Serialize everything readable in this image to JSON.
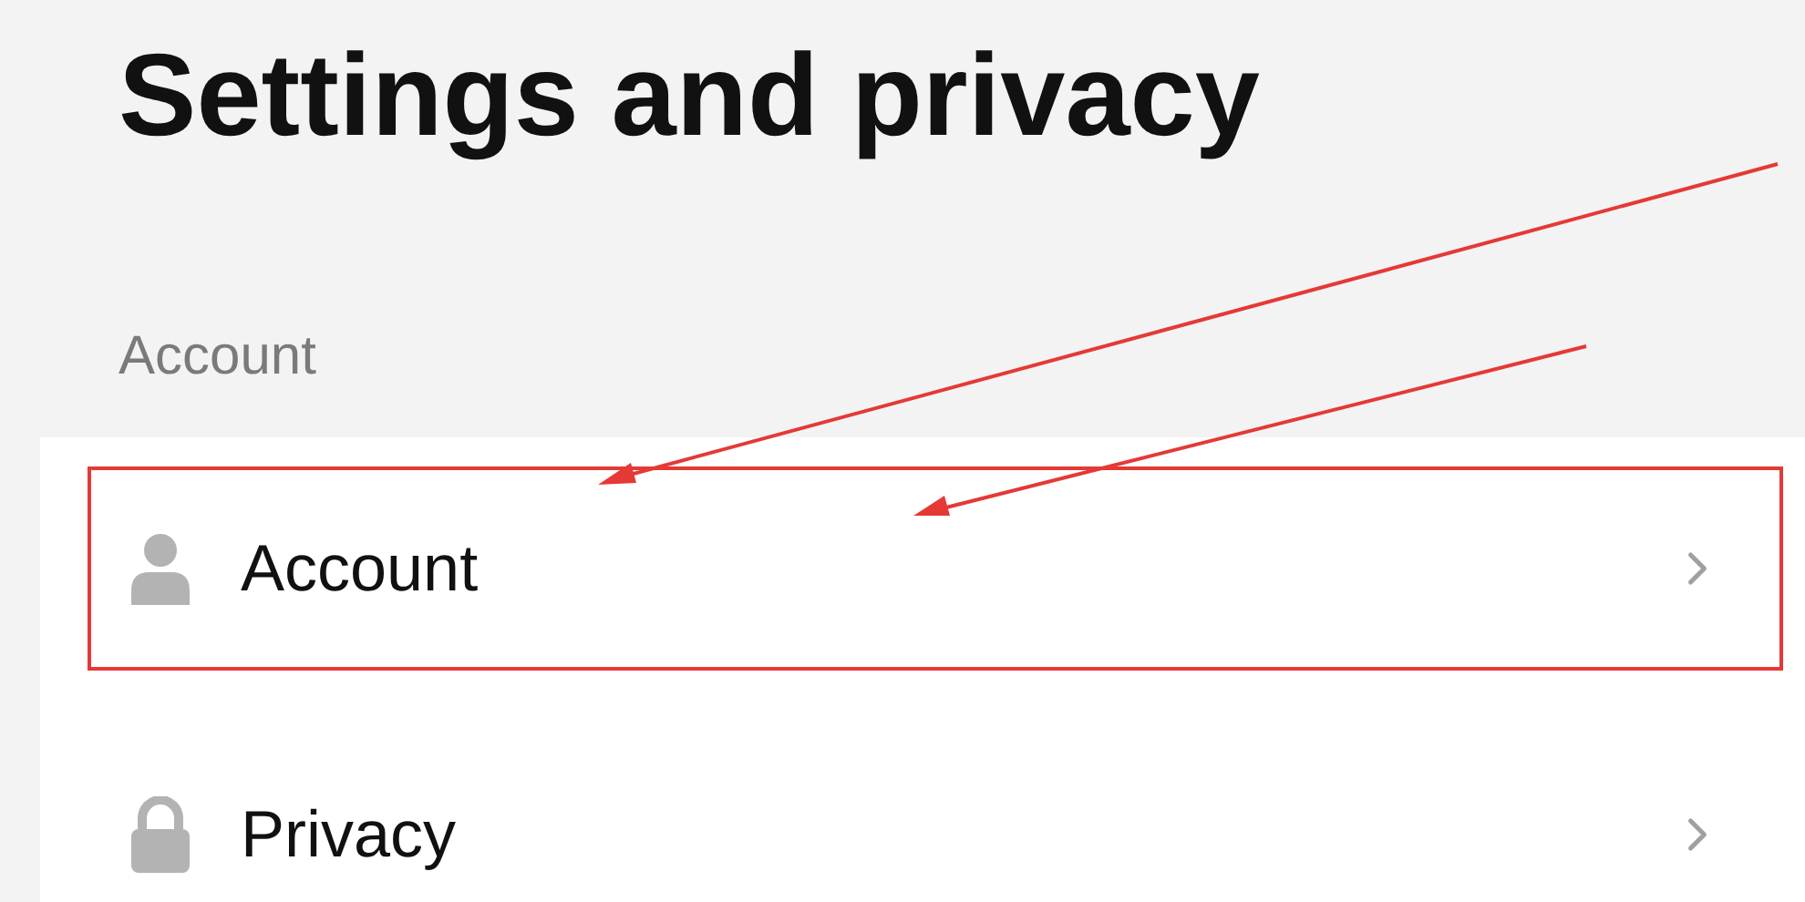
{
  "title": "Settings and privacy",
  "section": {
    "label": "Account"
  },
  "items": [
    {
      "kind": "person",
      "label": "Account",
      "highlighted": true
    },
    {
      "kind": "lock",
      "label": "Privacy",
      "highlighted": false
    }
  ]
}
